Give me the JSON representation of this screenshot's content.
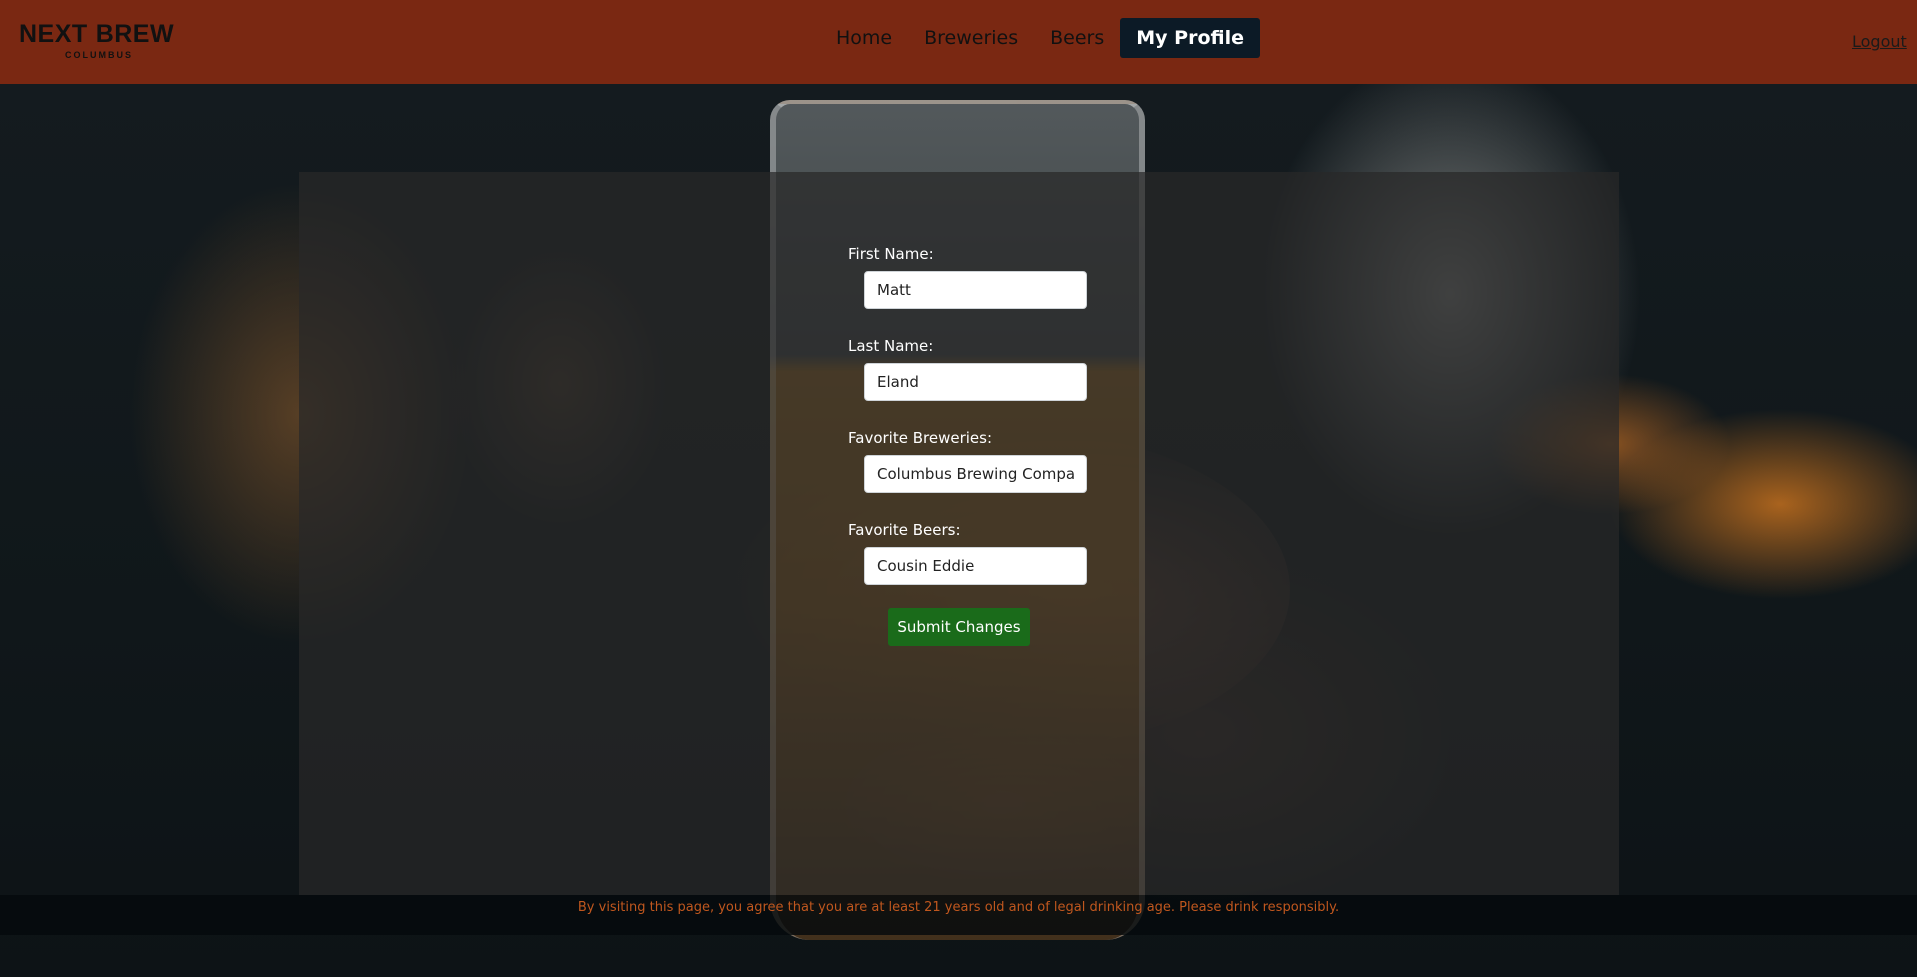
{
  "brand": {
    "name_left": "NEXT",
    "name_right": "BREW",
    "city": "COLUMBUS"
  },
  "nav": {
    "items": [
      {
        "label": "Home",
        "active": false
      },
      {
        "label": "Breweries",
        "active": false
      },
      {
        "label": "Beers",
        "active": false
      },
      {
        "label": "My Profile",
        "active": true
      }
    ],
    "logout": "Logout"
  },
  "form": {
    "first_name": {
      "label": "First Name:",
      "value": "Matt"
    },
    "last_name": {
      "label": "Last Name:",
      "value": "Eland"
    },
    "favorite_breweries": {
      "label": "Favorite Breweries:",
      "value": "Columbus Brewing Company"
    },
    "favorite_beers": {
      "label": "Favorite Beers:",
      "value": "Cousin Eddie"
    },
    "submit_label": "Submit Changes"
  },
  "footer": {
    "disclaimer": "By visiting this page, you agree that you are at least 21 years old and of legal drinking age. Please drink responsibly."
  },
  "colors": {
    "navbar": "#7a2812",
    "active_tab": "#0c1a26",
    "submit_button": "#1a6b1a",
    "footer_text": "#c0571e"
  }
}
